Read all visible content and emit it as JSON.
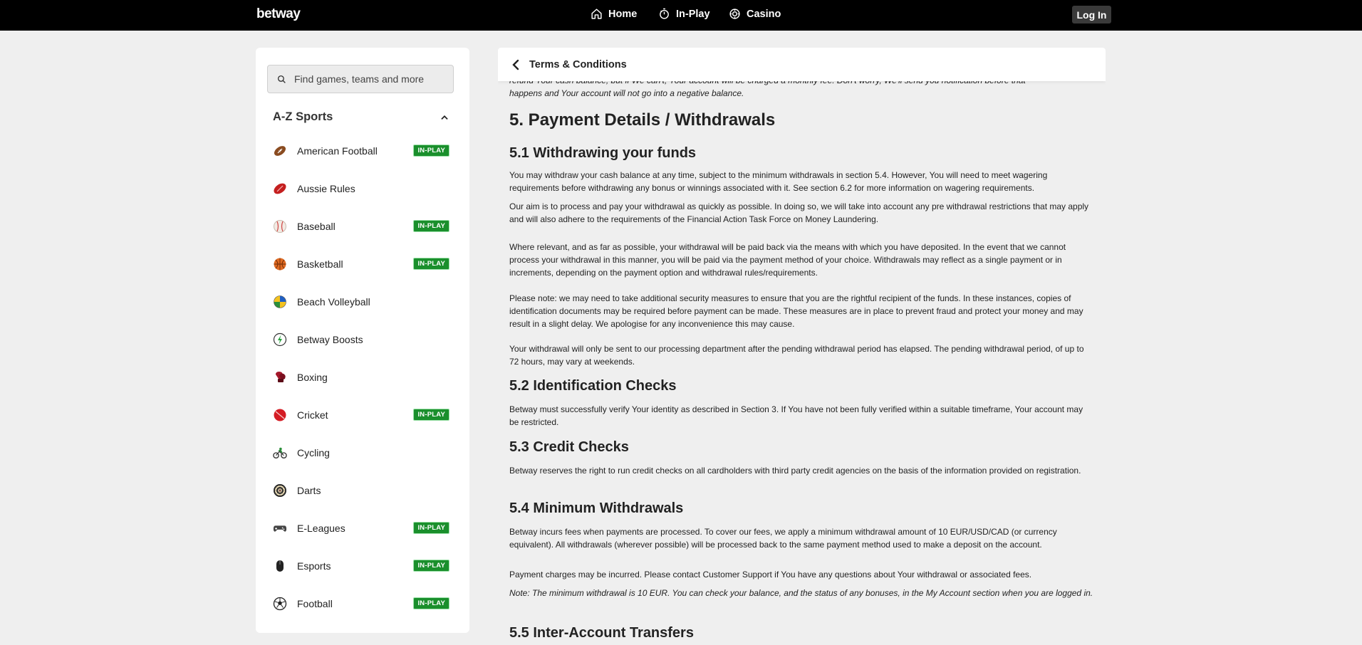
{
  "header": {
    "logo": "betway",
    "nav": [
      {
        "label": "Home",
        "icon": "home-icon"
      },
      {
        "label": "In-Play",
        "icon": "stopwatch-icon"
      },
      {
        "label": "Casino",
        "icon": "casino-chip-icon"
      }
    ],
    "login_label": "Log In"
  },
  "sidebar": {
    "search_placeholder": "Find games, teams and more",
    "az_title": "A-Z Sports",
    "inplay_badge": "IN-PLAY",
    "sports": [
      {
        "label": "American Football",
        "inplay": true
      },
      {
        "label": "Aussie Rules",
        "inplay": false
      },
      {
        "label": "Baseball",
        "inplay": true
      },
      {
        "label": "Basketball",
        "inplay": true
      },
      {
        "label": "Beach Volleyball",
        "inplay": false
      },
      {
        "label": "Betway Boosts",
        "inplay": false
      },
      {
        "label": "Boxing",
        "inplay": false
      },
      {
        "label": "Cricket",
        "inplay": true
      },
      {
        "label": "Cycling",
        "inplay": false
      },
      {
        "label": "Darts",
        "inplay": false
      },
      {
        "label": "E-Leagues",
        "inplay": true
      },
      {
        "label": "Esports",
        "inplay": true
      },
      {
        "label": "Football",
        "inplay": true
      }
    ]
  },
  "main": {
    "page_title": "Terms & Conditions",
    "partial_top": "refund Your cash balance, but if We can't, Your account will be charged a monthly fee. Don't worry, We'll send you notification before that",
    "intro_tail": "happens and Your account will not go into a negative balance.",
    "section5_title": "5. Payment Details / Withdrawals",
    "s51_title": "5.1 Withdrawing your funds",
    "s51_p1": "You may withdraw your cash balance at any time, subject to the minimum withdrawals in section 5.4. However, You will need to meet wagering requirements before withdrawing any bonus or winnings associated with it. See section 6.2 for more information on wagering requirements.",
    "s51_p2": "Our aim is to process and pay your withdrawal as quickly as possible. In doing so, we will take into account any pre withdrawal restrictions that may apply and will also adhere to the requirements of the Financial Action Task Force on Money Laundering.",
    "s51_p3": "Where relevant, and as far as possible, your withdrawal will be paid back via the means with which you have deposited. In the event that we cannot process your withdrawal in this manner, you will be paid via the payment method of your choice. Withdrawals may reflect as a single payment or in increments, depending on the payment option and withdrawal rules/requirements.",
    "s51_p4": "Please note: we may need to take additional security measures to ensure that you are the rightful recipient of the funds. In these instances, copies of identification documents may be required before payment can be made. These measures are in place to prevent fraud and protect your money and may result in a slight delay. We apologise for any inconvenience this may cause.",
    "s51_p5": "Your withdrawal will only be sent to our processing department after the pending withdrawal period has elapsed. The pending withdrawal period, of up to 72 hours, may vary at weekends.",
    "s52_title": "5.2 Identification Checks",
    "s52_p1": "Betway must successfully verify Your identity as described in Section 3. If You have not been fully verified within a suitable timeframe, Your account may be restricted.",
    "s53_title": "5.3 Credit Checks",
    "s53_p1": "Betway reserves the right to run credit checks on all cardholders with third party credit agencies on the basis of the information provided on registration.",
    "s54_title": "5.4 Minimum Withdrawals",
    "s54_p1": "Betway incurs fees when payments are processed. To cover our fees, we apply a minimum withdrawal amount of 10 EUR/USD/CAD (or currency equivalent). All withdrawals (wherever possible) will be processed back to the same payment method used to make a deposit on the account.",
    "s54_p2": "Payment charges may be incurred. Please contact Customer Support if You have any questions about Your withdrawal or associated fees.",
    "s54_note": "Note: The minimum withdrawal is 10 EUR. You can check your balance, and the status of any bonuses, in the My Account section when you are logged in.",
    "s55_title": "5.5 Inter-Account Transfers"
  }
}
